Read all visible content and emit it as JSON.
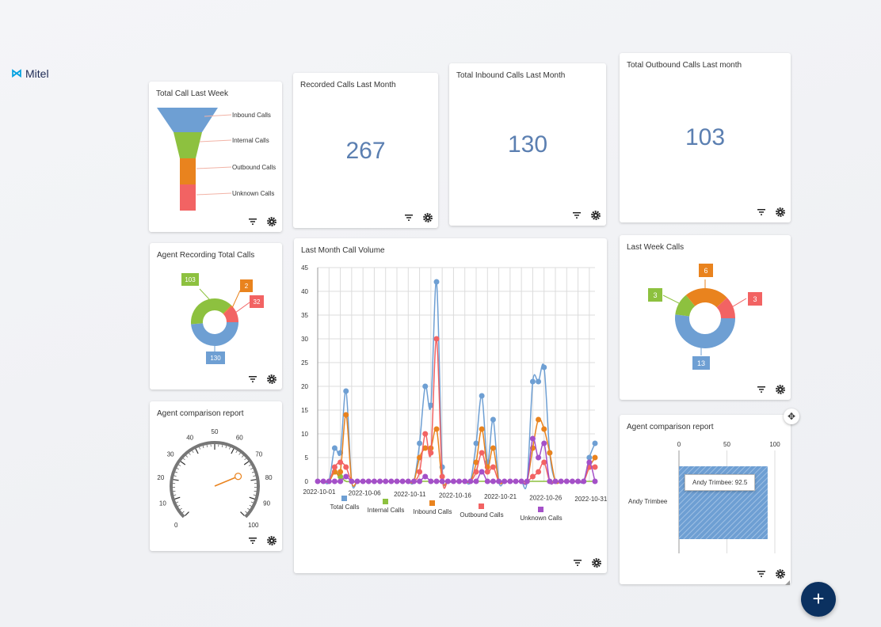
{
  "app": {
    "logo": "Mitel"
  },
  "cards": {
    "funnel": {
      "title": "Total Call Last Week",
      "labels": [
        "Inbound Calls",
        "Internal Calls",
        "Outbound Calls",
        "Unknown Calls"
      ],
      "colors": [
        "#6e9fd3",
        "#8dc13f",
        "#e9831e",
        "#f26363"
      ]
    },
    "recorded": {
      "title": "Recorded Calls Last Month",
      "value": "267"
    },
    "inbound": {
      "title": "Total Inbound Calls Last Month",
      "value": "130"
    },
    "outbound": {
      "title": "Total Outbound Calls Last month",
      "value": "103"
    },
    "agent_recording": {
      "title": "Agent Recording Total Calls",
      "labels": [
        "103",
        "2",
        "32",
        "130"
      ]
    },
    "volume": {
      "title": "Last Month Call Volume"
    },
    "last_week": {
      "title": "Last Week Calls",
      "labels": [
        "6",
        "3",
        "3",
        "13"
      ]
    },
    "gauge": {
      "title": "Agent comparison report",
      "ticks": [
        "0",
        "10",
        "20",
        "30",
        "40",
        "50",
        "60",
        "70",
        "80",
        "90",
        "100"
      ]
    },
    "agent_bar": {
      "title": "Agent comparison report",
      "axis_ticks": [
        "0",
        "50",
        "100"
      ],
      "category": "Andy Trimbee",
      "tooltip": "Andy Trimbee: 92.5"
    }
  },
  "chart_data": [
    {
      "type": "pie",
      "subtype": "funnel",
      "title": "Total Call Last Week",
      "categories": [
        "Inbound Calls",
        "Internal Calls",
        "Outbound Calls",
        "Unknown Calls"
      ],
      "colors": [
        "#6e9fd3",
        "#8dc13f",
        "#e9831e",
        "#f26363"
      ]
    },
    {
      "type": "pie",
      "subtype": "donut",
      "title": "Agent Recording Total Calls",
      "slices": [
        {
          "value": 130,
          "color": "#6e9fd3"
        },
        {
          "value": 103,
          "color": "#8dc13f"
        },
        {
          "value": 2,
          "color": "#e9831e"
        },
        {
          "value": 32,
          "color": "#f26363"
        }
      ]
    },
    {
      "type": "line",
      "title": "Last Month Call Volume",
      "x_tick_labels": [
        "2022-10-01",
        "2022-10-06",
        "2022-10-11",
        "2022-10-16",
        "2022-10-21",
        "2022-10-26",
        "2022-10-31"
      ],
      "x_start": "2022-10-01",
      "y_ticks": [
        0,
        5,
        10,
        15,
        20,
        25,
        30,
        35,
        40,
        45
      ],
      "ylim": [
        0,
        45
      ],
      "grid": true,
      "legend_position": "bottom",
      "series": [
        {
          "name": "Total Calls",
          "color": "#6e9fd3",
          "values": [
            0,
            0,
            0,
            7,
            6,
            19,
            0,
            0,
            0,
            0,
            0,
            0,
            0,
            0,
            0,
            0,
            0,
            0,
            8,
            20,
            16,
            42,
            3,
            0,
            0,
            0,
            0,
            0,
            8,
            18,
            4,
            13,
            0,
            0,
            0,
            0,
            0,
            0,
            21,
            21,
            24,
            6,
            0,
            0,
            0,
            0,
            0,
            0,
            5,
            8
          ]
        },
        {
          "name": "Internal Calls",
          "color": "#8dc13f",
          "values": [
            0,
            0,
            0,
            2,
            1,
            0,
            0,
            0,
            0,
            0,
            0,
            0,
            0,
            0,
            0,
            0,
            0,
            0,
            0,
            0,
            0,
            0,
            0,
            0,
            0,
            0,
            0,
            0,
            0,
            0,
            0,
            0,
            0,
            0,
            0,
            0,
            0,
            0,
            0,
            0,
            0,
            0,
            0,
            0,
            0,
            0,
            0,
            0,
            0,
            0
          ]
        },
        {
          "name": "Inbound Calls",
          "color": "#e9831e",
          "values": [
            0,
            0,
            0,
            2,
            2,
            14,
            0,
            0,
            0,
            0,
            0,
            0,
            0,
            0,
            0,
            0,
            0,
            0,
            5,
            7,
            7,
            11,
            0,
            0,
            0,
            0,
            0,
            0,
            4,
            11,
            3,
            7,
            0,
            0,
            0,
            0,
            0,
            0,
            7,
            13,
            11,
            6,
            0,
            0,
            0,
            0,
            0,
            0,
            3,
            5
          ]
        },
        {
          "name": "Outbound Calls",
          "color": "#f26363",
          "values": [
            0,
            0,
            0,
            3,
            4,
            3,
            0,
            0,
            0,
            0,
            0,
            0,
            0,
            0,
            0,
            0,
            0,
            0,
            2,
            10,
            6,
            30,
            1,
            0,
            0,
            0,
            0,
            0,
            2,
            6,
            2,
            3,
            0,
            0,
            0,
            0,
            0,
            0,
            1,
            2,
            4,
            0,
            0,
            0,
            0,
            0,
            0,
            0,
            3,
            3
          ]
        },
        {
          "name": "Unknown Calls",
          "color": "#a450c8",
          "values": [
            0,
            0,
            0,
            0,
            0,
            1,
            0,
            0,
            0,
            0,
            0,
            0,
            0,
            0,
            0,
            0,
            0,
            0,
            0,
            1,
            0,
            0,
            0,
            0,
            0,
            0,
            0,
            0,
            0,
            2,
            0,
            0,
            0,
            0,
            0,
            0,
            0,
            0,
            9,
            5,
            8,
            0,
            0,
            0,
            0,
            0,
            0,
            0,
            4,
            0
          ]
        }
      ]
    },
    {
      "type": "pie",
      "subtype": "donut",
      "title": "Last Week Calls",
      "slices": [
        {
          "value": 13,
          "color": "#6e9fd3"
        },
        {
          "value": 3,
          "color": "#8dc13f"
        },
        {
          "value": 6,
          "color": "#e9831e"
        },
        {
          "value": 3,
          "color": "#f26363"
        }
      ]
    },
    {
      "type": "gauge",
      "title": "Agent comparison report",
      "min": 0,
      "max": 100,
      "value": 75
    },
    {
      "type": "bar",
      "orientation": "horizontal",
      "title": "Agent comparison report",
      "categories": [
        "Andy Trimbee"
      ],
      "values": [
        92.5
      ],
      "xlim": [
        0,
        100
      ],
      "x_ticks": [
        0,
        50,
        100
      ],
      "color": "#6e9fd3"
    }
  ]
}
